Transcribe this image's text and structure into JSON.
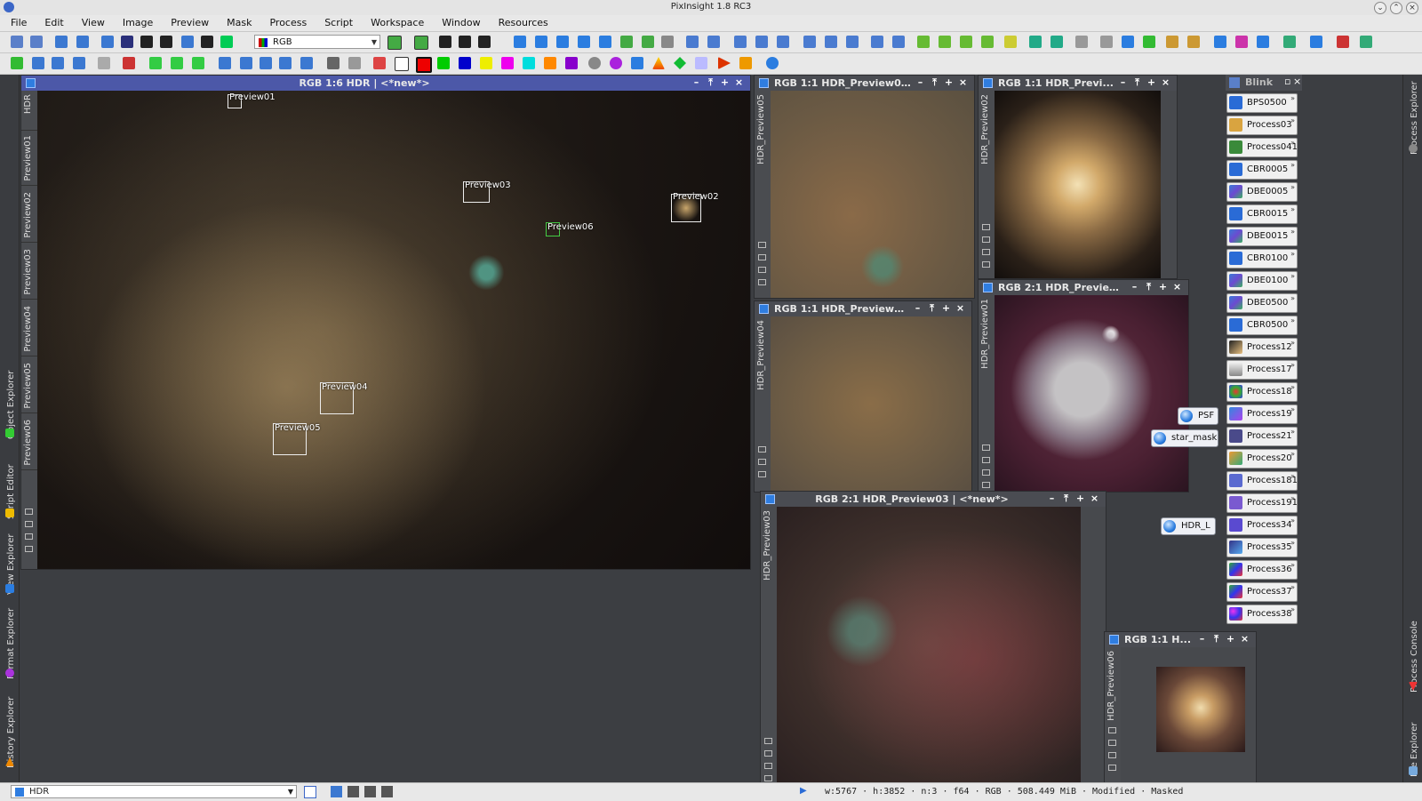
{
  "app": {
    "title": "PixInsight 1.8 RC3"
  },
  "menu": [
    "File",
    "Edit",
    "View",
    "Image",
    "Preview",
    "Mask",
    "Process",
    "Script",
    "Workspace",
    "Window",
    "Resources"
  ],
  "toolbar": {
    "channel_combo": "RGB"
  },
  "left_dock": [
    "Object Explorer",
    "Script Editor",
    "View Explorer",
    "Format Explorer",
    "History Explorer"
  ],
  "right_dock": [
    "Process Explorer",
    "Process Console",
    "File Explorer"
  ],
  "main_window": {
    "title": "RGB 1:6 HDR | <*new*>",
    "side_tabs": [
      "HDR",
      "Preview01",
      "Preview02",
      "Preview03",
      "Preview04",
      "Preview05",
      "Preview06"
    ],
    "previews": [
      "Preview01",
      "Preview02",
      "Preview03",
      "Preview04",
      "Preview05",
      "Preview06"
    ]
  },
  "windows": [
    {
      "title": "RGB 1:1 HDR_Preview05...",
      "side": "HDR_Preview05"
    },
    {
      "title": "RGB 1:1 HDR_Previ...",
      "side": "HDR_Preview02"
    },
    {
      "title": "RGB 1:1 HDR_Preview0...",
      "side": "HDR_Preview04"
    },
    {
      "title": "RGB 2:1 HDR_Preview...",
      "side": "HDR_Preview01"
    },
    {
      "title": "RGB 2:1 HDR_Preview03 | <*new*>",
      "side": "HDR_Preview03"
    },
    {
      "title": "RGB 1:1 H...",
      "side": "HDR_Preview06"
    }
  ],
  "blink": {
    "title": "Blink"
  },
  "icons": [
    "BPS0500",
    "Process03",
    "Process041",
    "CBR0005",
    "DBE0005",
    "CBR0015",
    "DBE0015",
    "CBR0100",
    "DBE0100",
    "DBE0500",
    "CBR0500",
    "Process12",
    "Process17",
    "Process18",
    "Process19",
    "Process21",
    "Process20",
    "Process181",
    "Process191",
    "Process34",
    "Process35",
    "Process36",
    "Process37",
    "Process38"
  ],
  "process_icons": {
    "psf": "PSF",
    "star_mask": "star_mask",
    "hdr_l": "HDR_L"
  },
  "status": {
    "view": "HDR",
    "info": "w:5767 · h:3852 · n:3 · f64 · RGB · 508.449 MiB · Modified · Masked"
  }
}
